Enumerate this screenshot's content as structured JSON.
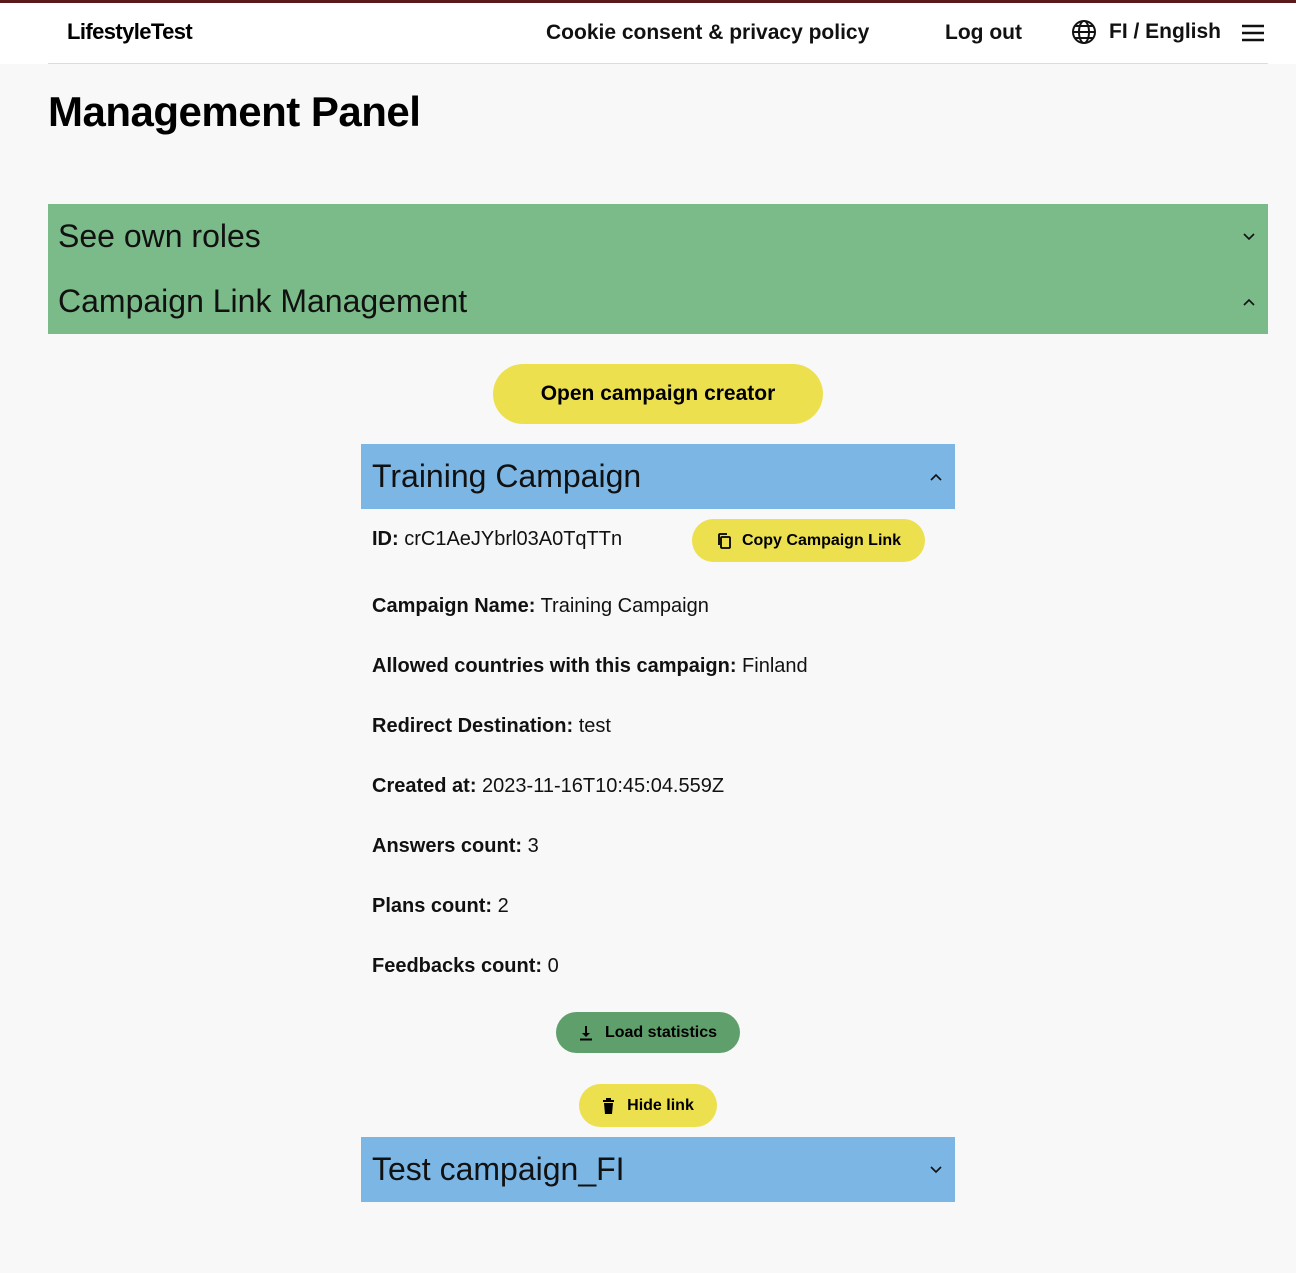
{
  "header": {
    "logo": "LifestyleTest",
    "nav": {
      "cookie": "Cookie consent & privacy policy",
      "logout": "Log out",
      "language": "FI / English"
    },
    "icons": [
      "globe-icon",
      "hamburger-menu-icon"
    ]
  },
  "page": {
    "title": "Management Panel"
  },
  "accordions": {
    "roles": "See own roles",
    "campaign_management": "Campaign Link Management"
  },
  "actions": {
    "open_creator": "Open campaign creator"
  },
  "campaigns": [
    {
      "title": "Training Campaign",
      "expanded": true,
      "id_label": "ID:",
      "id_value": "crC1AeJYbrl03A0TqTTn",
      "copy_label": "Copy Campaign Link",
      "fields": [
        {
          "label": "Campaign Name:",
          "value": "Training Campaign"
        },
        {
          "label": "Allowed countries with this campaign:",
          "value": "Finland"
        },
        {
          "label": "Redirect Destination:",
          "value": "test"
        },
        {
          "label": "Created at:",
          "value": "2023-11-16T10:45:04.559Z"
        },
        {
          "label": "Answers count:",
          "value": "3"
        },
        {
          "label": "Plans count:",
          "value": "2"
        },
        {
          "label": "Feedbacks count:",
          "value": "0"
        }
      ],
      "load_statistics_label": "Load statistics",
      "hide_link_label": "Hide link"
    },
    {
      "title": "Test campaign_FI",
      "expanded": false
    }
  ],
  "colors": {
    "green_panel": "#7bba89",
    "blue_panel": "#7cb6e4",
    "yellow_button": "#ece04e",
    "green_button": "#5f9f6c",
    "top_border": "#5a1a1a"
  }
}
